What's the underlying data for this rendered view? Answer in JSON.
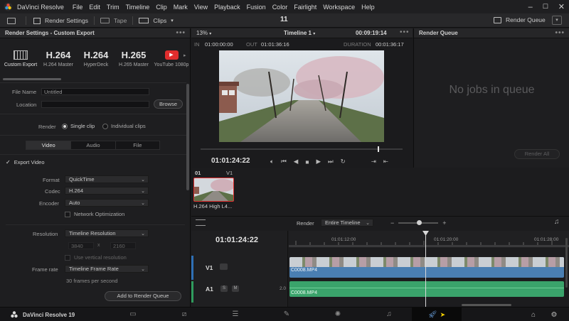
{
  "app": {
    "title": "DaVinci Resolve",
    "menus": [
      "File",
      "Edit",
      "Trim",
      "Timeline",
      "Clip",
      "Mark",
      "View",
      "Playback",
      "Fusion",
      "Color",
      "Fairlight",
      "Workspace",
      "Help"
    ]
  },
  "toolbar": {
    "render_settings": "Render Settings",
    "tape": "Tape",
    "clips": "Clips",
    "page_number": "11",
    "render_queue": "Render Queue"
  },
  "render_settings": {
    "title": "Render Settings - Custom Export",
    "presets": [
      {
        "big": "",
        "label": "Custom Export"
      },
      {
        "big": "H.264",
        "label": "H.264 Master"
      },
      {
        "big": "H.264",
        "label": "HyperDeck"
      },
      {
        "big": "H.265",
        "label": "H.265 Master"
      },
      {
        "big": "",
        "label": "YouTube 1080p"
      }
    ],
    "file_name_label": "File Name",
    "file_name_value": "Untitled",
    "location_label": "Location",
    "browse": "Browse",
    "render_label": "Render",
    "single_clip": "Single clip",
    "individual_clips": "Individual clips",
    "tabs": [
      "Video",
      "Audio",
      "File"
    ],
    "export_video": "Export Video",
    "format_label": "Format",
    "format_value": "QuickTime",
    "codec_label": "Codec",
    "codec_value": "H.264",
    "encoder_label": "Encoder",
    "encoder_value": "Auto",
    "network_opt": "Network Optimization",
    "resolution_label": "Resolution",
    "resolution_value": "Timeline Resolution",
    "res_w": "3840",
    "res_x": "x",
    "res_h": "2160",
    "vertical_res": "Use vertical resolution",
    "framerate_label": "Frame rate",
    "framerate_value": "Timeline Frame Rate",
    "fps_note": "30 frames per second",
    "add_to_queue": "Add to Render Queue"
  },
  "viewer": {
    "zoom": "13%",
    "timeline_name": "Timeline 1",
    "duration_top": "00:09:19:14",
    "in_label": "IN",
    "in_value": "01:00:00:00",
    "out_label": "OUT",
    "out_value": "01:01:36:16",
    "duration_label": "DURATION",
    "duration_value": "00:01:36:17",
    "timecode": "01:01:24:22",
    "playhead_fraction": 0.88
  },
  "queue": {
    "title": "Render Queue",
    "empty": "No jobs in queue",
    "render_all": "Render All"
  },
  "pool": {
    "index": "01",
    "track": "V1",
    "clip_name": "H.264 High L4..."
  },
  "timeline": {
    "render_label": "Render",
    "render_value": "Entire Timeline",
    "timecode": "01:01:24:22",
    "ruler": [
      "01:01:12:00",
      "01:01:20:00",
      "01:01:28:00"
    ],
    "v1": "V1",
    "a1": "A1",
    "a1_level": "2.0",
    "video_clip": "C0008.MP4",
    "audio_clip": "C0008.MP4",
    "solo": "S",
    "mute": "M"
  },
  "footer": {
    "app_version": "DaVinci Resolve 19"
  },
  "colors": {
    "accent_red": "#e02d2d",
    "video_clip": "#4a7fb2",
    "audio_clip": "#3aa36b",
    "active_page": "#0a0a0a"
  }
}
